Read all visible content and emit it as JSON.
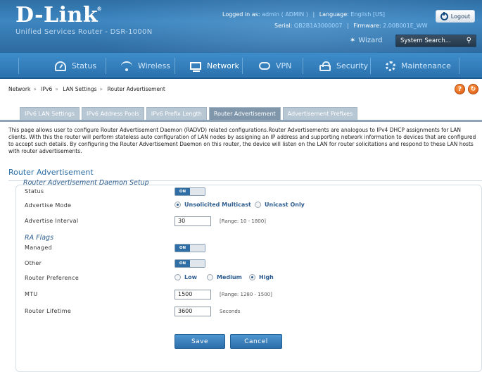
{
  "header": {
    "logo": "D-Link",
    "product": "Unified Services Router - DSR-1000N",
    "logged_in_label": "Logged in as:",
    "logged_in_value": "admin ( ADMIN )",
    "language_label": "Language:",
    "language_value": "English [US]",
    "serial_label": "Serial:",
    "serial_value": "QB2B1A3000007",
    "firmware_label": "Firmware:",
    "firmware_value": "2.00B001E_WW",
    "logout_label": "Logout",
    "wizard_label": "Wizard",
    "search_placeholder": "System Search..."
  },
  "nav": [
    {
      "label": "Status",
      "icon": "status-icon"
    },
    {
      "label": "Wireless",
      "icon": "wireless-icon"
    },
    {
      "label": "Network",
      "icon": "network-icon",
      "active": true
    },
    {
      "label": "VPN",
      "icon": "vpn-icon"
    },
    {
      "label": "Security",
      "icon": "security-icon"
    },
    {
      "label": "Maintenance",
      "icon": "maintenance-icon"
    }
  ],
  "breadcrumb": [
    "Network",
    "IPv6",
    "LAN Settings",
    "Router Advertisement"
  ],
  "tabs": [
    {
      "label": "IPv6 LAN Settings"
    },
    {
      "label": "IPv6 Address Pools"
    },
    {
      "label": "IPv6 Prefix Length"
    },
    {
      "label": "Router Advertisement",
      "active": true
    },
    {
      "label": "Advertisement Prefixes"
    }
  ],
  "description": "This page allows user to configure Router Advertisement Daemon (RADVD) related configurations.Router Advertisements are analogous to IPv4 DHCP assignments for LAN clients. With this the router will perform stateless auto configuration of LAN nodes by assigning an IP address and supporting network information to devices that are configured to accept such details. By configuring the Router Advertisement Daemon on this router, the device will listen on the LAN for router solicitations and respond to these LAN hosts with router advertisements.",
  "section_title": "Router Advertisement",
  "form": {
    "daemon_title": "Router Advertisement Daemon Setup",
    "status_label": "Status",
    "status_on": "ON",
    "advertise_mode_label": "Advertise Mode",
    "mode_options": [
      "Unsolicited Multicast",
      "Unicast Only"
    ],
    "mode_selected": "Unsolicited Multicast",
    "interval_label": "Advertise Interval",
    "interval_value": "30",
    "interval_hint": "[Range: 10 - 1800]",
    "ra_flags_title": "RA Flags",
    "managed_label": "Managed",
    "managed_on": "ON",
    "other_label": "Other",
    "other_on": "ON",
    "preference_label": "Router Preference",
    "preference_options": [
      "Low",
      "Medium",
      "High"
    ],
    "preference_selected": "High",
    "mtu_label": "MTU",
    "mtu_value": "1500",
    "mtu_hint": "[Range: 1280 - 1500]",
    "lifetime_label": "Router Lifetime",
    "lifetime_value": "3600",
    "lifetime_unit": "Seconds",
    "save_label": "Save",
    "cancel_label": "Cancel"
  },
  "help": {
    "help_icon": "?",
    "refresh_icon": "refresh"
  }
}
